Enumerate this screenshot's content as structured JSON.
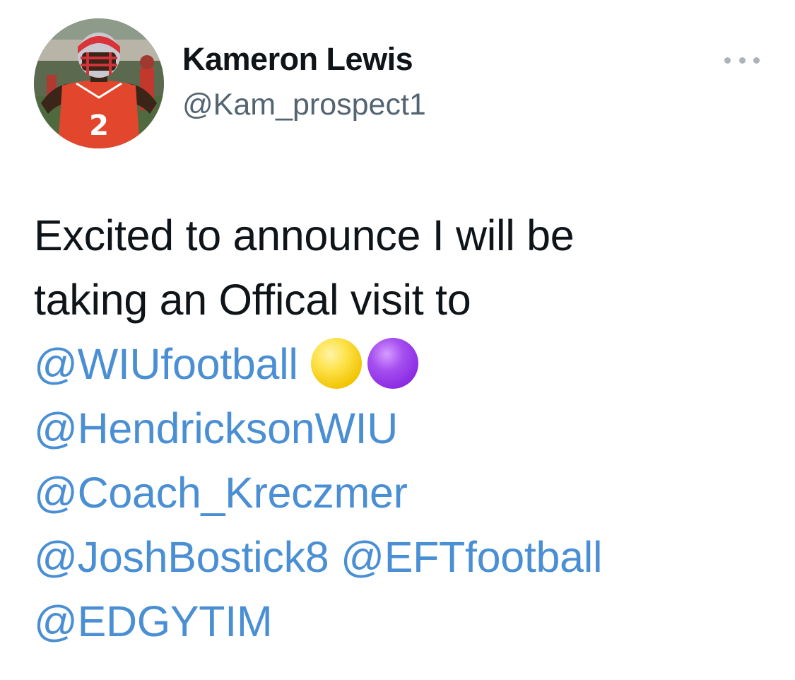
{
  "author": {
    "name": "Kameron Lewis",
    "handle": "@Kam_prospect1",
    "avatar_icon": "profile-photo-football-player",
    "jersey_number": "2"
  },
  "more_icon": "more-horizontal-icon",
  "tweet": {
    "text_line_1": "Excited to announce I will be",
    "text_line_2": "taking an Offical visit to",
    "mentions": [
      "@WIUfootball",
      "@HendricksonWIU",
      "@Coach_Kreczmer",
      "@JoshBostick8",
      "@EFTfootball",
      "@EDGYTIM"
    ],
    "emojis": [
      {
        "name": "yellow-circle",
        "color": "#fde24a"
      },
      {
        "name": "purple-circle",
        "color": "#a54ff0"
      }
    ]
  },
  "colors": {
    "link": "#4a8fd4",
    "text": "#0f1419",
    "secondary": "#536471"
  }
}
